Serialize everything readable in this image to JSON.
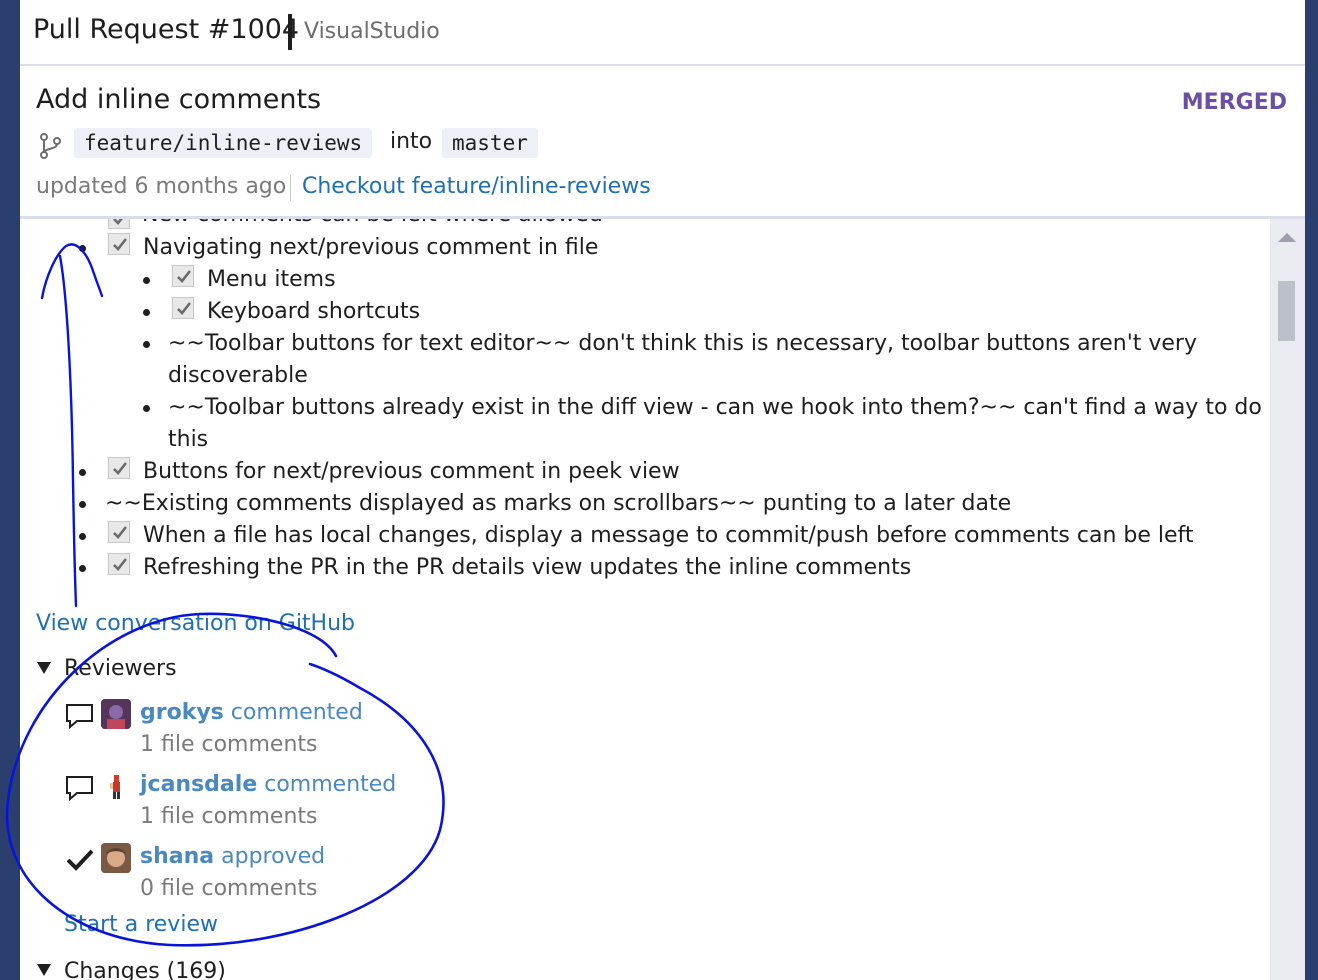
{
  "window": {
    "title": "Pull Request #1004",
    "repo": "VisualStudio"
  },
  "pr": {
    "title": "Add inline comments",
    "state": "MERGED",
    "source_branch": "feature/inline-reviews",
    "into_label": "into",
    "target_branch": "master",
    "updated": "updated 6 months ago",
    "checkout_label": "Checkout feature/inline-reviews"
  },
  "description": {
    "cutoff_text": "New comments can be left where allowed",
    "items": [
      {
        "text": "Navigating next/previous comment in file",
        "checked": true
      },
      {
        "text": "Menu items",
        "checked": true
      },
      {
        "text": "Keyboard shortcuts",
        "checked": true
      },
      {
        "text": "~~Toolbar buttons for text editor~~ don't think this is necessary, toolbar buttons aren't very",
        "text2": "discoverable"
      },
      {
        "text": "~~Toolbar buttons already exist in the diff view - can we hook into them?~~ can't find a way to do",
        "text2": "this"
      },
      {
        "text": "Buttons for next/previous comment in peek view",
        "checked": true
      },
      {
        "text": "~~Existing comments displayed as marks on scrollbars~~ punting to a later date"
      },
      {
        "text": "When a file has local changes, display a message to commit/push before comments can be left",
        "checked": true
      },
      {
        "text": "Refreshing the PR in the PR details view updates the inline comments",
        "checked": true
      }
    ]
  },
  "view_on_github": "View conversation on GitHub",
  "reviewers": {
    "heading": "Reviewers",
    "list": [
      {
        "name": "grokys",
        "action": "commented",
        "comments": "1 file comments",
        "icon": "comment-icon"
      },
      {
        "name": "jcansdale",
        "action": "commented",
        "comments": "1 file comments",
        "icon": "comment-icon"
      },
      {
        "name": "shana",
        "action": "approved",
        "comments": "0 file comments",
        "icon": "checkmark-icon"
      }
    ],
    "start_review": "Start a review"
  },
  "changes": {
    "heading": "Changes (169)"
  },
  "colors": {
    "accent_link": "#1f6fb2",
    "merged": "#6b4fa3",
    "annotation_ink": "#0a14d8"
  }
}
